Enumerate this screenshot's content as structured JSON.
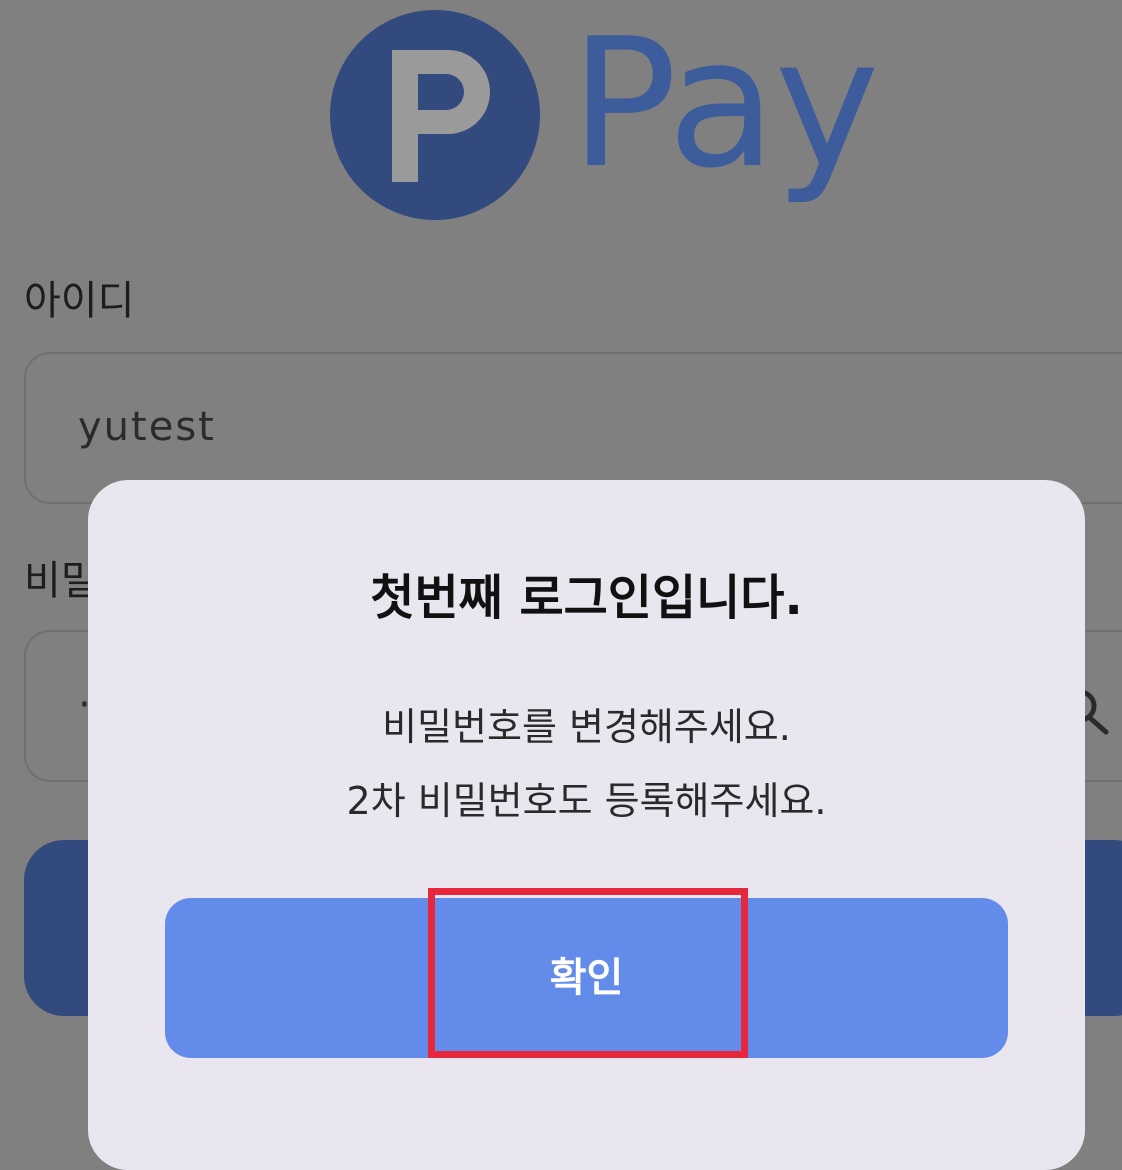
{
  "app": {
    "logo_word": "Pay",
    "logo_letter": "P"
  },
  "form": {
    "id_label": "아이디",
    "id_value": "yutest",
    "password_label_visible": "비밀",
    "password_mask": "·"
  },
  "dialog": {
    "title": "첫번째 로그인입니다.",
    "message_line1": "비밀번호를 변경해주세요.",
    "message_line2": "2차 비밀번호도 등록해주세요.",
    "confirm_label": "확인"
  },
  "colors": {
    "overlay_background": "#808080",
    "brand_dark": "#324a7d",
    "brand_text": "#3d5c9c",
    "dialog_background": "#eae6f0",
    "confirm_button": "#638bea",
    "highlight": "#e8263c"
  }
}
